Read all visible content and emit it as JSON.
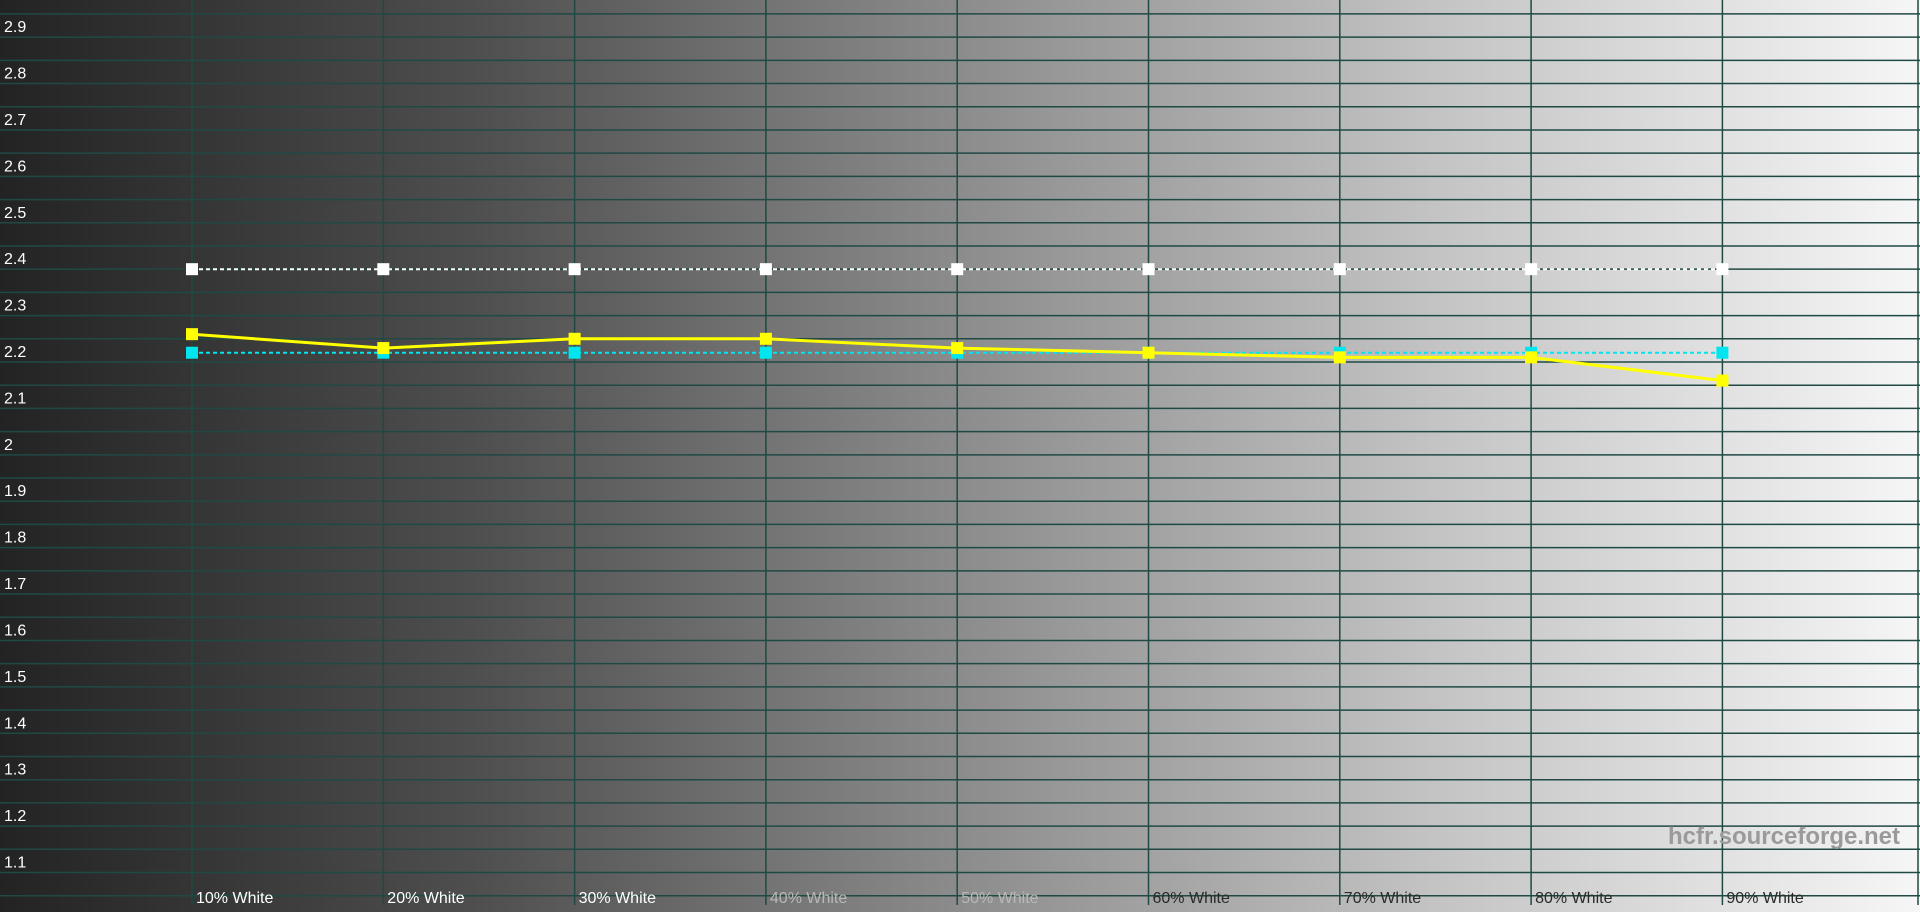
{
  "chart_data": {
    "type": "line",
    "categories": [
      "10% White",
      "20% White",
      "30% White",
      "40% White",
      "50% White",
      "60% White",
      "70% White",
      "80% White",
      "90% White"
    ],
    "y_ticks": [
      "1.1",
      "1.2",
      "1.3",
      "1.4",
      "1.5",
      "1.6",
      "1.7",
      "1.8",
      "1.9",
      "2",
      "2.1",
      "2.2",
      "2.3",
      "2.4",
      "2.5",
      "2.6",
      "2.7",
      "2.8",
      "2.9"
    ],
    "ylim": [
      1.03,
      2.98
    ],
    "grid": true,
    "series": [
      {
        "color": "#ffffff",
        "line": "dashed",
        "values": [
          2.4,
          2.4,
          2.4,
          2.4,
          2.4,
          2.4,
          2.4,
          2.4,
          2.4
        ]
      },
      {
        "color": "#00e5ee",
        "line": "dashed",
        "values": [
          2.22,
          2.22,
          2.22,
          2.22,
          2.22,
          2.22,
          2.22,
          2.22,
          2.22
        ]
      },
      {
        "color": "#ffff00",
        "line": "solid",
        "values": [
          2.26,
          2.23,
          2.25,
          2.25,
          2.23,
          2.22,
          2.21,
          2.21,
          2.16
        ]
      }
    ],
    "watermark": "hcfr.sourceforge.net"
  }
}
